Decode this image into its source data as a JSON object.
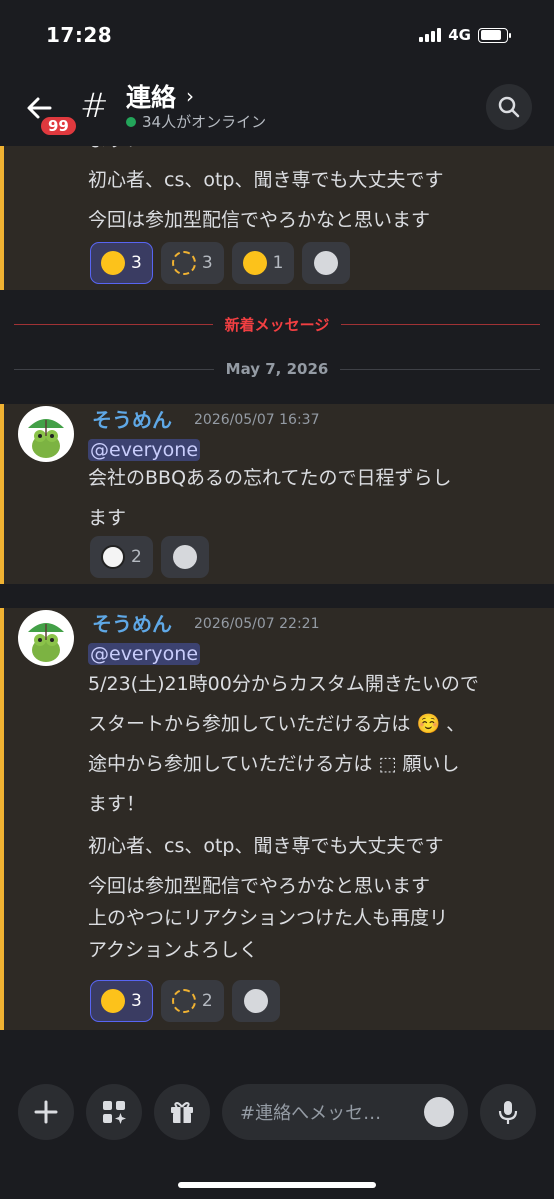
{
  "status_bar": {
    "time": "17:28",
    "network": "4G"
  },
  "header": {
    "badge": "99",
    "channel_name": "連絡",
    "online_text": "34人がオンライン"
  },
  "chat": {
    "partial_message": {
      "cut_line": "ます！",
      "lines": [
        "初心者、cs、otp、聞き専でも大丈夫です",
        "今回は参加型配信でやろかなと思います"
      ],
      "reactions": [
        {
          "emoji": "☺️",
          "count": "3",
          "mine": true
        },
        {
          "emoji": "dotted-face",
          "count": "3",
          "mine": false
        },
        {
          "emoji": "😁",
          "count": "1",
          "mine": false
        }
      ]
    },
    "new_messages_label": "新着メッセージ",
    "date_label": "May 7, 2026",
    "messages": [
      {
        "author": "そうめん",
        "timestamp": "2026/05/07 16:37",
        "mention": "@everyone",
        "lines": [
          "会社のBBQあるの忘れてたので日程ずらし",
          "ます"
        ],
        "reactions": [
          {
            "emoji": "🐼",
            "count": "2",
            "mine": false
          }
        ]
      },
      {
        "author": "そうめん",
        "timestamp": "2026/05/07 22:21",
        "mention": "@everyone",
        "lines": [
          "5/23(土)21時00分からカスタム開きたいので",
          "スタートから参加していただける方は ☺️ 、",
          "途中から参加していただける方は ⬚ 願いし",
          "ます！",
          "初心者、cs、otp、聞き専でも大丈夫です",
          "今回は参加型配信でやろかなと思います",
          "上のやつにリアクションつけた人も再度リ",
          "アクションよろしく"
        ],
        "reactions": [
          {
            "emoji": "☺️",
            "count": "3",
            "mine": true
          },
          {
            "emoji": "dotted-face",
            "count": "2",
            "mine": false
          }
        ]
      }
    ]
  },
  "composer": {
    "placeholder": "#連絡へメッセ…"
  },
  "colors": {
    "accent": "#5865f2",
    "highlight_border": "#f0b232",
    "new_divider": "#f23f42",
    "author": "#5fa8e6"
  }
}
